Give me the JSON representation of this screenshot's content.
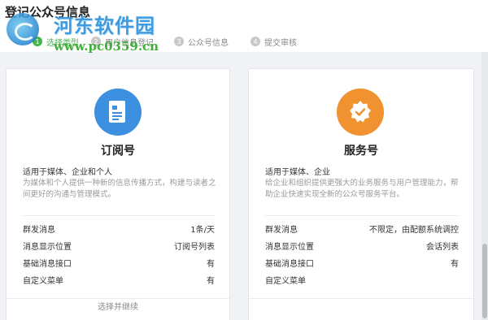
{
  "page": {
    "title": "登记公众号信息"
  },
  "watermark": {
    "name": "河东软件园",
    "url": "www.pc0359.cn"
  },
  "steps": [
    {
      "num": "1",
      "label": "选择类型"
    },
    {
      "num": "2",
      "label": "用户信息登记"
    },
    {
      "num": "3",
      "label": "公众号信息"
    },
    {
      "num": "4",
      "label": "提交审核"
    }
  ],
  "colors": {
    "accent_green": "#44b549",
    "subscription_blue": "#3d8fe0",
    "service_orange": "#f0922f"
  },
  "cards": [
    {
      "icon": "document-icon",
      "title": "订阅号",
      "subtitle": "适用于媒体、企业和个人",
      "description": "为媒体和个人提供一种新的信息传播方式，构建与读者之间更好的沟通与管理模式。",
      "rows": [
        {
          "label": "群发消息",
          "value": "1条/天"
        },
        {
          "label": "消息显示位置",
          "value": "订阅号列表"
        },
        {
          "label": "基础消息接口",
          "value": "有"
        },
        {
          "label": "自定义菜单",
          "value": "有"
        }
      ],
      "action": "选择并继续"
    },
    {
      "icon": "verified-badge-icon",
      "title": "服务号",
      "subtitle": "适用于媒体、企业",
      "description": "给企业和组织提供更强大的业务服务与用户管理能力，帮助企业快速实现全新的公众号服务平台。",
      "rows": [
        {
          "label": "群发消息",
          "value": "不限定，由配额系统调控"
        },
        {
          "label": "消息显示位置",
          "value": "会话列表"
        },
        {
          "label": "基础消息接口",
          "value": "有"
        },
        {
          "label": "自定义菜单",
          "value": ""
        }
      ],
      "action": ""
    }
  ]
}
